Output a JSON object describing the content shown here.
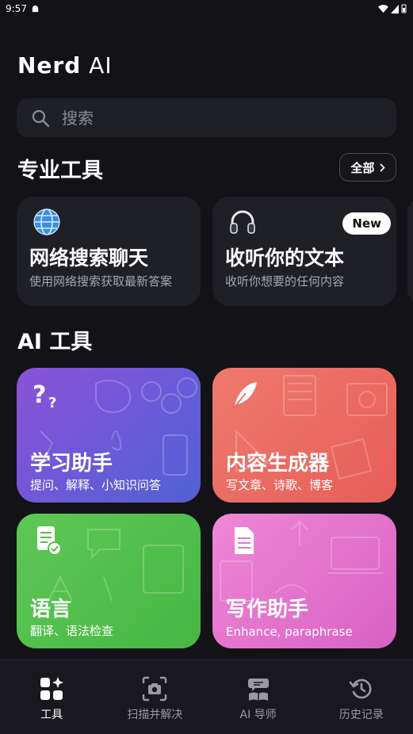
{
  "status_bar": {
    "time": "9:57"
  },
  "header": {
    "title_bold": "Nerd",
    "title_light": " AI"
  },
  "search": {
    "placeholder": "搜索"
  },
  "pro_tools": {
    "section_title": "专业工具",
    "see_all_label": "全部",
    "cards": [
      {
        "title": "网络搜索聊天",
        "subtitle": "使用网络搜索获取最新答案",
        "icon": "globe-icon"
      },
      {
        "title": "收听你的文本",
        "subtitle": "收听你想要的任何内容",
        "icon": "headphones-icon",
        "badge": "New"
      }
    ]
  },
  "ai_tools": {
    "section_title": "AI 工具",
    "cards": [
      {
        "title": "学习助手",
        "subtitle": "提问、解释、小知识问答",
        "icon": "question-marks-icon",
        "color": "#7a57d8"
      },
      {
        "title": "内容生成器",
        "subtitle": "写文章、诗歌、博客",
        "icon": "feather-icon",
        "color": "#e96b62"
      },
      {
        "title": "语言",
        "subtitle": "翻译、语法检查",
        "icon": "document-check-icon",
        "color": "#52bf4c"
      },
      {
        "title": "写作助手",
        "subtitle": "Enhance, paraphrase",
        "icon": "document-icon",
        "color": "#e474cf"
      }
    ]
  },
  "bottom_nav": {
    "items": [
      {
        "label": "工具",
        "icon": "tools-grid-icon",
        "active": true
      },
      {
        "label": "扫描并解决",
        "icon": "camera-scan-icon",
        "active": false
      },
      {
        "label": "AI 导师",
        "icon": "tutor-icon",
        "active": false
      },
      {
        "label": "历史记录",
        "icon": "history-icon",
        "active": false
      }
    ]
  }
}
